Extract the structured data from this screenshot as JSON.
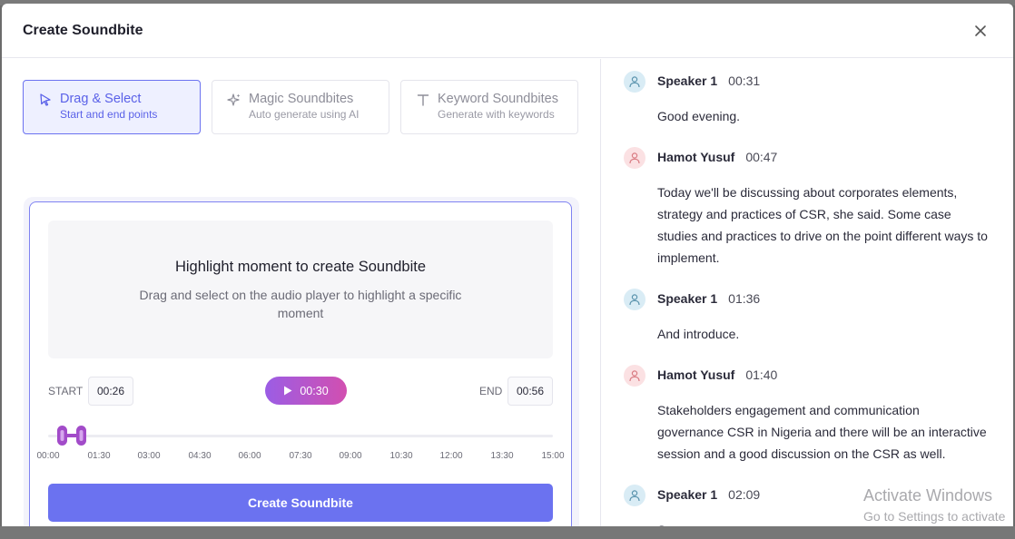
{
  "modal": {
    "title": "Create Soundbite"
  },
  "modes": [
    {
      "title": "Drag & Select",
      "subtitle": "Start and end points",
      "icon": "cursor-icon",
      "active": true
    },
    {
      "title": "Magic Soundbites",
      "subtitle": "Auto generate using AI",
      "icon": "sparkle-icon",
      "active": false
    },
    {
      "title": "Keyword Soundbites",
      "subtitle": "Generate with keywords",
      "icon": "text-icon",
      "active": false
    }
  ],
  "hint": {
    "title": "Highlight moment to create Soundbite",
    "text": "Drag and select on the audio player to highlight a specific moment"
  },
  "player": {
    "start_label": "START",
    "start_value": "00:26",
    "play_label": "00:30",
    "end_label": "END",
    "end_value": "00:56",
    "ticks": [
      "00:00",
      "01:30",
      "03:00",
      "04:30",
      "06:00",
      "07:30",
      "09:00",
      "10:30",
      "12:00",
      "13:30",
      "15:00"
    ]
  },
  "create_button": "Create Soundbite",
  "transcript": [
    {
      "speaker": "Speaker 1",
      "time": "00:31",
      "text": "Good evening.",
      "avatar": "blue"
    },
    {
      "speaker": "Hamot Yusuf",
      "time": "00:47",
      "text": "Today we'll be discussing about corporates elements, strategy and practices of CSR, she said. Some case studies and practices to drive on the point different ways to implement.",
      "avatar": "pink"
    },
    {
      "speaker": "Speaker 1",
      "time": "01:36",
      "text": "And introduce.",
      "avatar": "blue"
    },
    {
      "speaker": "Hamot Yusuf",
      "time": "01:40",
      "text": "Stakeholders engagement and communication governance CSR in Nigeria and there will be an interactive session and a good discussion on the CSR as well.",
      "avatar": "pink"
    },
    {
      "speaker": "Speaker 1",
      "time": "02:09",
      "text": "So.",
      "avatar": "blue"
    }
  ],
  "watermark": {
    "line1": "Activate Windows",
    "line2": "Go to Settings to activate"
  },
  "colors": {
    "accent": "#6b72f0",
    "play_gradient_start": "#9b5de5",
    "play_gradient_end": "#d24fb0"
  }
}
